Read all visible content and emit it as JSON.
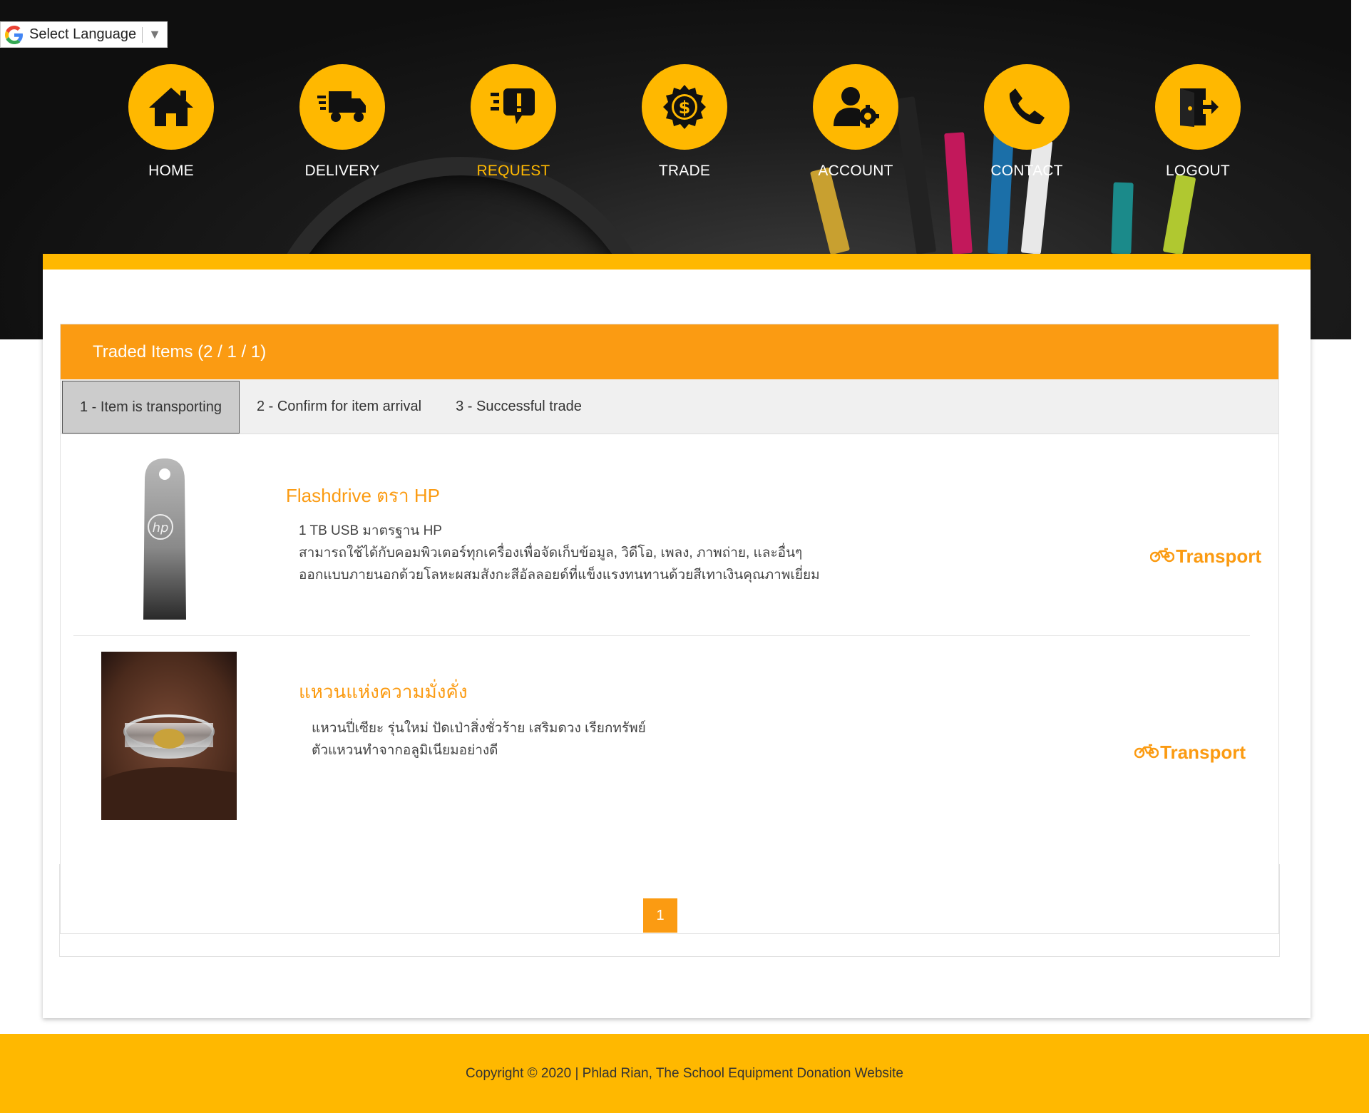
{
  "language": {
    "label": "Select Language",
    "arrow": "▼"
  },
  "nav": [
    {
      "label": "HOME",
      "icon": "home-icon",
      "active": false
    },
    {
      "label": "DELIVERY",
      "icon": "delivery-truck-icon",
      "active": false
    },
    {
      "label": "REQUEST",
      "icon": "request-chat-icon",
      "active": true
    },
    {
      "label": "TRADE",
      "icon": "trade-dollar-icon",
      "active": false
    },
    {
      "label": "ACCOUNT",
      "icon": "account-settings-icon",
      "active": false
    },
    {
      "label": "CONTACT",
      "icon": "phone-icon",
      "active": false
    },
    {
      "label": "LOGOUT",
      "icon": "logout-door-icon",
      "active": false
    }
  ],
  "card": {
    "title": "Traded Items (2 / 1 / 1)",
    "tabs": [
      {
        "label": "1 - Item is transporting",
        "active": true
      },
      {
        "label": "2 - Confirm for item arrival",
        "active": false
      },
      {
        "label": "3 - Successful trade",
        "active": false
      }
    ],
    "items": [
      {
        "title": "Flashdrive ตรา HP",
        "desc": [
          "1 TB USB มาตรฐาน HP",
          "สามารถใช้ได้กับคอมพิวเตอร์ทุกเครื่องเพื่อจัดเก็บข้อมูล, วิดีโอ, เพลง, ภาพถ่าย, และอื่นๆ",
          "ออกแบบภายนอกด้วยโลหะผสมสังกะสีอัลลอยด์ที่แข็งแรงทนทานด้วยสีเทาเงินคุณภาพเยี่ยม"
        ],
        "action": "Transport",
        "image": "usb-flashdrive-image"
      },
      {
        "title": "แหวนแห่งความมั่งคั่ง",
        "desc": [
          "แหวนปี่เซียะ รุ่นใหม่ ปัดเป่าสิ่งชั่วร้าย เสริมดวง เรียกทรัพย์",
          "ตัวแหวนทำจากอลูมิเนียมอย่างดี"
        ],
        "action": "Transport",
        "image": "ring-image"
      }
    ],
    "page": "1"
  },
  "footer": "Copyright © 2020 | Phlad Rian, The School Equipment Donation Website",
  "colors": {
    "accent": "#ffb800",
    "orange": "#fb9b12"
  }
}
